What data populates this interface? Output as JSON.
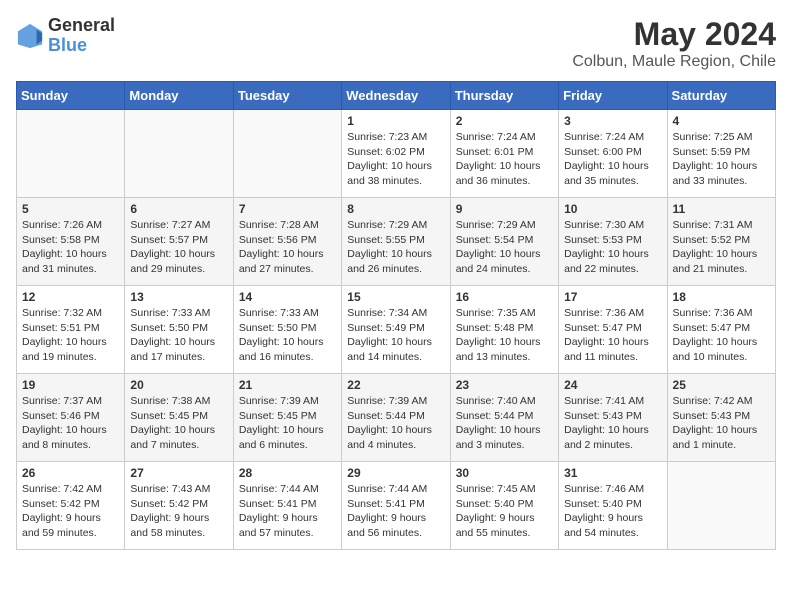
{
  "header": {
    "logo_line1": "General",
    "logo_line2": "Blue",
    "title": "May 2024",
    "subtitle": "Colbun, Maule Region, Chile"
  },
  "days_of_week": [
    "Sunday",
    "Monday",
    "Tuesday",
    "Wednesday",
    "Thursday",
    "Friday",
    "Saturday"
  ],
  "weeks": [
    [
      {
        "day": "",
        "info": ""
      },
      {
        "day": "",
        "info": ""
      },
      {
        "day": "",
        "info": ""
      },
      {
        "day": "1",
        "info": "Sunrise: 7:23 AM\nSunset: 6:02 PM\nDaylight: 10 hours\nand 38 minutes."
      },
      {
        "day": "2",
        "info": "Sunrise: 7:24 AM\nSunset: 6:01 PM\nDaylight: 10 hours\nand 36 minutes."
      },
      {
        "day": "3",
        "info": "Sunrise: 7:24 AM\nSunset: 6:00 PM\nDaylight: 10 hours\nand 35 minutes."
      },
      {
        "day": "4",
        "info": "Sunrise: 7:25 AM\nSunset: 5:59 PM\nDaylight: 10 hours\nand 33 minutes."
      }
    ],
    [
      {
        "day": "5",
        "info": "Sunrise: 7:26 AM\nSunset: 5:58 PM\nDaylight: 10 hours\nand 31 minutes."
      },
      {
        "day": "6",
        "info": "Sunrise: 7:27 AM\nSunset: 5:57 PM\nDaylight: 10 hours\nand 29 minutes."
      },
      {
        "day": "7",
        "info": "Sunrise: 7:28 AM\nSunset: 5:56 PM\nDaylight: 10 hours\nand 27 minutes."
      },
      {
        "day": "8",
        "info": "Sunrise: 7:29 AM\nSunset: 5:55 PM\nDaylight: 10 hours\nand 26 minutes."
      },
      {
        "day": "9",
        "info": "Sunrise: 7:29 AM\nSunset: 5:54 PM\nDaylight: 10 hours\nand 24 minutes."
      },
      {
        "day": "10",
        "info": "Sunrise: 7:30 AM\nSunset: 5:53 PM\nDaylight: 10 hours\nand 22 minutes."
      },
      {
        "day": "11",
        "info": "Sunrise: 7:31 AM\nSunset: 5:52 PM\nDaylight: 10 hours\nand 21 minutes."
      }
    ],
    [
      {
        "day": "12",
        "info": "Sunrise: 7:32 AM\nSunset: 5:51 PM\nDaylight: 10 hours\nand 19 minutes."
      },
      {
        "day": "13",
        "info": "Sunrise: 7:33 AM\nSunset: 5:50 PM\nDaylight: 10 hours\nand 17 minutes."
      },
      {
        "day": "14",
        "info": "Sunrise: 7:33 AM\nSunset: 5:50 PM\nDaylight: 10 hours\nand 16 minutes."
      },
      {
        "day": "15",
        "info": "Sunrise: 7:34 AM\nSunset: 5:49 PM\nDaylight: 10 hours\nand 14 minutes."
      },
      {
        "day": "16",
        "info": "Sunrise: 7:35 AM\nSunset: 5:48 PM\nDaylight: 10 hours\nand 13 minutes."
      },
      {
        "day": "17",
        "info": "Sunrise: 7:36 AM\nSunset: 5:47 PM\nDaylight: 10 hours\nand 11 minutes."
      },
      {
        "day": "18",
        "info": "Sunrise: 7:36 AM\nSunset: 5:47 PM\nDaylight: 10 hours\nand 10 minutes."
      }
    ],
    [
      {
        "day": "19",
        "info": "Sunrise: 7:37 AM\nSunset: 5:46 PM\nDaylight: 10 hours\nand 8 minutes."
      },
      {
        "day": "20",
        "info": "Sunrise: 7:38 AM\nSunset: 5:45 PM\nDaylight: 10 hours\nand 7 minutes."
      },
      {
        "day": "21",
        "info": "Sunrise: 7:39 AM\nSunset: 5:45 PM\nDaylight: 10 hours\nand 6 minutes."
      },
      {
        "day": "22",
        "info": "Sunrise: 7:39 AM\nSunset: 5:44 PM\nDaylight: 10 hours\nand 4 minutes."
      },
      {
        "day": "23",
        "info": "Sunrise: 7:40 AM\nSunset: 5:44 PM\nDaylight: 10 hours\nand 3 minutes."
      },
      {
        "day": "24",
        "info": "Sunrise: 7:41 AM\nSunset: 5:43 PM\nDaylight: 10 hours\nand 2 minutes."
      },
      {
        "day": "25",
        "info": "Sunrise: 7:42 AM\nSunset: 5:43 PM\nDaylight: 10 hours\nand 1 minute."
      }
    ],
    [
      {
        "day": "26",
        "info": "Sunrise: 7:42 AM\nSunset: 5:42 PM\nDaylight: 9 hours\nand 59 minutes."
      },
      {
        "day": "27",
        "info": "Sunrise: 7:43 AM\nSunset: 5:42 PM\nDaylight: 9 hours\nand 58 minutes."
      },
      {
        "day": "28",
        "info": "Sunrise: 7:44 AM\nSunset: 5:41 PM\nDaylight: 9 hours\nand 57 minutes."
      },
      {
        "day": "29",
        "info": "Sunrise: 7:44 AM\nSunset: 5:41 PM\nDaylight: 9 hours\nand 56 minutes."
      },
      {
        "day": "30",
        "info": "Sunrise: 7:45 AM\nSunset: 5:40 PM\nDaylight: 9 hours\nand 55 minutes."
      },
      {
        "day": "31",
        "info": "Sunrise: 7:46 AM\nSunset: 5:40 PM\nDaylight: 9 hours\nand 54 minutes."
      },
      {
        "day": "",
        "info": ""
      }
    ]
  ]
}
